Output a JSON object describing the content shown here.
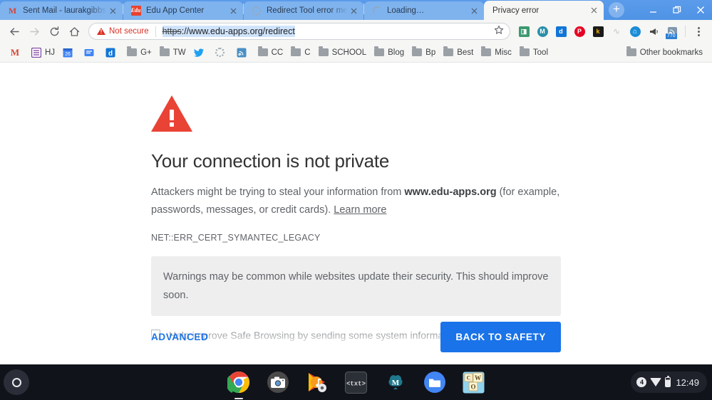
{
  "window": {
    "minimize_label": "Minimize",
    "restore_label": "Restore",
    "close_label": "Close"
  },
  "tabs": [
    {
      "title": "Sent Mail - laurakgibbs@g",
      "favicon": "gmail-icon",
      "active": false
    },
    {
      "title": "Edu App Center",
      "favicon": "edu-app-center-icon",
      "active": false
    },
    {
      "title": "Redirect Tool error messa",
      "favicon": "loading-spinner-icon",
      "active": false
    },
    {
      "title": "Loading…",
      "favicon": "loading-spinner-icon",
      "active": false
    },
    {
      "title": "Privacy error",
      "favicon": "none",
      "active": true
    }
  ],
  "newtab": {
    "label": "+"
  },
  "toolbar": {
    "back_label": "←",
    "forward_label": "→",
    "reload_label": "↻",
    "home_label": "⌂",
    "security_label": "Not secure",
    "url_scheme": "https",
    "url_rest": "://www.edu-apps.org/redirect",
    "url_full": "https://www.edu-apps.org/redirect",
    "bookmark_star_label": "☆",
    "menu_label": "Chrome menu",
    "extensions": [
      {
        "name": "screen-capture-extension",
        "glyph": "◨",
        "color": "#3d9970"
      },
      {
        "name": "mendeley-extension",
        "glyph": "M",
        "color": "#2a8fa8"
      },
      {
        "name": "diigo-extension",
        "glyph": "d",
        "color": "#1275d6"
      },
      {
        "name": "pinterest-extension",
        "glyph": "P",
        "color": "#e60023"
      },
      {
        "name": "kindle-extension",
        "glyph": "k",
        "color": "#1a1a1a"
      },
      {
        "name": "muted-extension",
        "glyph": "∿",
        "color": "#c3c5c8"
      },
      {
        "name": "internet-archive-extension",
        "glyph": "⌂",
        "color": "#1a8cd8"
      },
      {
        "name": "announcement-extension",
        "glyph": "⌗",
        "color": "#4a4a4a"
      },
      {
        "name": "feedly-extension",
        "glyph": "◠",
        "color": "#5a7a92",
        "badge": "770"
      }
    ]
  },
  "bookmarks": {
    "items": [
      {
        "label": "",
        "icon": "gmail-icon"
      },
      {
        "label": "HJ",
        "icon": "list-icon"
      },
      {
        "label": "",
        "icon": "calendar-26-icon"
      },
      {
        "label": "",
        "icon": "keep-icon"
      },
      {
        "label": "",
        "icon": "diigo-icon"
      },
      {
        "label": "G+",
        "icon": "folder-icon"
      },
      {
        "label": "TW",
        "icon": "folder-icon"
      },
      {
        "label": "",
        "icon": "twitter-icon"
      },
      {
        "label": "",
        "icon": "loading-spinner-icon"
      },
      {
        "label": "",
        "icon": "feedly-icon"
      },
      {
        "label": "CC",
        "icon": "folder-icon"
      },
      {
        "label": "C",
        "icon": "folder-icon"
      },
      {
        "label": "SCHOOL",
        "icon": "folder-icon"
      },
      {
        "label": "Blog",
        "icon": "folder-icon"
      },
      {
        "label": "Bp",
        "icon": "folder-icon"
      },
      {
        "label": "Best",
        "icon": "folder-icon"
      },
      {
        "label": "Misc",
        "icon": "folder-icon"
      },
      {
        "label": "Tool",
        "icon": "folder-icon"
      }
    ],
    "other": {
      "label": "Other bookmarks",
      "icon": "folder-icon"
    }
  },
  "interstitial": {
    "icon": "warning-triangle-icon",
    "headline": "Your connection is not private",
    "body_prefix": "Attackers might be trying to steal your information from ",
    "body_domain": "www.edu-apps.org",
    "body_suffix": " (for example, passwords, messages, or credit cards). ",
    "learn_more": "Learn more",
    "error_code": "NET::ERR_CERT_SYMANTEC_LEGACY",
    "info_box": "Warnings may be common while websites update their security. This should improve soon.",
    "safe_browsing_text": "Help improve Safe Browsing by sending some system information and page content to",
    "advanced_label": "ADVANCED",
    "back_to_safety_label": "BACK TO SAFETY",
    "accent_color": "#1a73e8",
    "warning_color": "#e94335"
  },
  "shelf": {
    "launcher_label": "Launcher",
    "apps": [
      {
        "name": "chrome-app",
        "running": true
      },
      {
        "name": "camera-app",
        "running": false
      },
      {
        "name": "play-music-app",
        "running": false
      },
      {
        "name": "text-editor-app",
        "label": "<txt>",
        "running": false
      },
      {
        "name": "mendeley-app",
        "label": "M",
        "running": false
      },
      {
        "name": "files-app",
        "running": false
      },
      {
        "name": "words-game-app",
        "running": false
      }
    ],
    "tray": {
      "notification_count": "4",
      "network_icon": "wifi-icon",
      "battery_icon": "battery-icon",
      "time": "12:49"
    }
  }
}
